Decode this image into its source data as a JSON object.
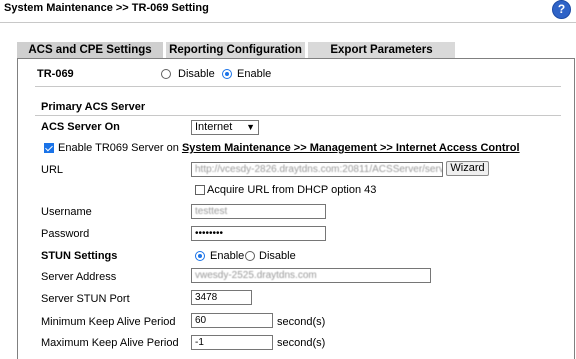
{
  "header": {
    "title": "System Maintenance >> TR-069 Setting",
    "help_icon": "?"
  },
  "tabs": [
    {
      "label": "ACS and CPE Settings",
      "active": true
    },
    {
      "label": "Reporting Configuration",
      "active": false
    },
    {
      "label": "Export Parameters",
      "active": false
    }
  ],
  "tr069": {
    "label": "TR-069",
    "disable_label": "Disable",
    "enable_label": "Enable",
    "selected": "Enable"
  },
  "primary_acs": {
    "section_title": "Primary ACS Server",
    "server_on_label": "ACS Server On",
    "server_on_value": "Internet",
    "enable_server_text": "Enable TR069 Server on",
    "enable_server_link": "System Maintenance >> Management >> Internet Access Control",
    "url_label": "URL",
    "url_value": "http://vcesdy-2826.draytdns.com:20811/ACSServer/services/ACSServlet",
    "wizard_label": "Wizard",
    "acquire_label": "Acquire URL from DHCP option 43",
    "username_label": "Username",
    "username_value": "testtest",
    "password_label": "Password",
    "password_value": "••••••••"
  },
  "stun": {
    "section_title": "STUN Settings",
    "enable_label": "Enable",
    "disable_label": "Disable",
    "selected": "Enable",
    "server_address_label": "Server Address",
    "server_address_value": "vwesdy-2525.draytdns.com",
    "server_port_label": "Server STUN Port",
    "server_port_value": "3478",
    "min_keep_label": "Minimum Keep Alive Period",
    "min_keep_value": "60",
    "min_keep_unit": "second(s)",
    "max_keep_label": "Maximum Keep Alive Period",
    "max_keep_value": "-1",
    "max_keep_unit": "second(s)"
  },
  "colors": {
    "accent": "#1a73e8",
    "help_icon_bg": "#2f63c7",
    "tab_bg": "#d9d9d9"
  }
}
